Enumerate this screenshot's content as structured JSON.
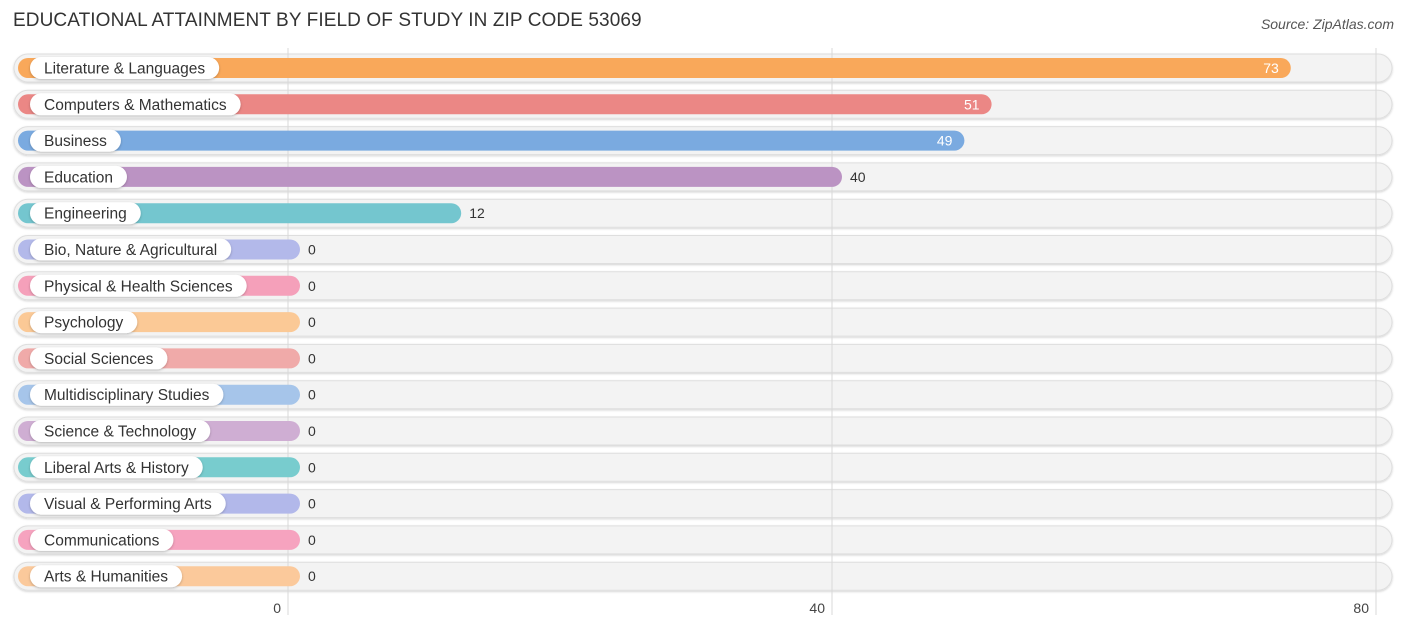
{
  "header": {
    "title": "EDUCATIONAL ATTAINMENT BY FIELD OF STUDY IN ZIP CODE 53069",
    "source": "Source: ZipAtlas.com"
  },
  "chart_data": {
    "type": "bar",
    "orientation": "horizontal",
    "title": "EDUCATIONAL ATTAINMENT BY FIELD OF STUDY IN ZIP CODE 53069",
    "xlabel": "",
    "ylabel": "",
    "xlim": [
      0,
      80
    ],
    "ticks": [
      0,
      40,
      80
    ],
    "tick_labels": [
      "0",
      "40",
      "80"
    ],
    "grid": true,
    "categories": [
      "Literature & Languages",
      "Computers & Mathematics",
      "Business",
      "Education",
      "Engineering",
      "Bio, Nature & Agricultural",
      "Physical & Health Sciences",
      "Psychology",
      "Social Sciences",
      "Multidisciplinary Studies",
      "Science & Technology",
      "Liberal Arts & History",
      "Visual & Performing Arts",
      "Communications",
      "Arts & Humanities"
    ],
    "values": [
      73,
      51,
      49,
      40,
      12,
      0,
      0,
      0,
      0,
      0,
      0,
      0,
      0,
      0,
      0
    ],
    "value_labels": [
      "73",
      "51",
      "49",
      "40",
      "12",
      "0",
      "0",
      "0",
      "0",
      "0",
      "0",
      "0",
      "0",
      "0",
      "0"
    ],
    "colors": [
      "#f9a85a",
      "#eb8785",
      "#7aaae0",
      "#bb93c3",
      "#74c6cf",
      "#b3b9ea",
      "#f5a0ba",
      "#fbc996",
      "#f0aaa9",
      "#a6c5ea",
      "#cfaed3",
      "#78ccce",
      "#b2b8ea",
      "#f6a3bf",
      "#fbc99b"
    ]
  }
}
